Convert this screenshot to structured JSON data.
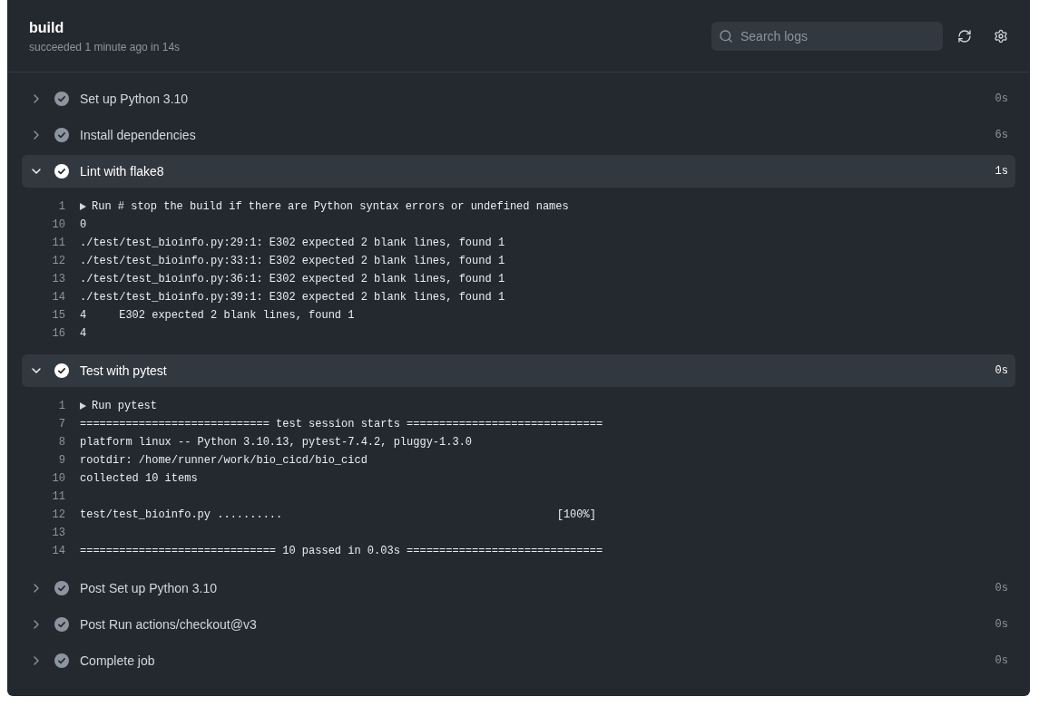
{
  "job": {
    "title": "build",
    "summary": "succeeded 1 minute ago in 14s"
  },
  "search": {
    "placeholder": "Search logs"
  },
  "steps": [
    {
      "name": "Set up Python 3.10",
      "duration": "0s",
      "expanded": false
    },
    {
      "name": "Install dependencies",
      "duration": "6s",
      "expanded": false
    },
    {
      "name": "Lint with flake8",
      "duration": "1s",
      "expanded": true,
      "log": {
        "group": {
          "number": "1",
          "text": "Run # stop the build if there are Python syntax errors or undefined names",
          "expanded": false
        },
        "lines": [
          {
            "number": "10",
            "text": "0"
          },
          {
            "number": "11",
            "text": "./test/test_bioinfo.py:29:1: E302 expected 2 blank lines, found 1"
          },
          {
            "number": "12",
            "text": "./test/test_bioinfo.py:33:1: E302 expected 2 blank lines, found 1"
          },
          {
            "number": "13",
            "text": "./test/test_bioinfo.py:36:1: E302 expected 2 blank lines, found 1"
          },
          {
            "number": "14",
            "text": "./test/test_bioinfo.py:39:1: E302 expected 2 blank lines, found 1"
          },
          {
            "number": "15",
            "text": "4     E302 expected 2 blank lines, found 1"
          },
          {
            "number": "16",
            "text": "4"
          }
        ]
      }
    },
    {
      "name": "Test with pytest",
      "duration": "0s",
      "expanded": true,
      "log": {
        "group": {
          "number": "1",
          "text": "Run pytest",
          "expanded": false
        },
        "lines": [
          {
            "number": "7",
            "text": "============================= test session starts =============================="
          },
          {
            "number": "8",
            "text": "platform linux -- Python 3.10.13, pytest-7.4.2, pluggy-1.3.0"
          },
          {
            "number": "9",
            "text": "rootdir: /home/runner/work/bio_cicd/bio_cicd"
          },
          {
            "number": "10",
            "text": "collected 10 items"
          },
          {
            "number": "11"
          },
          {
            "number": "12",
            "text": "test/test_bioinfo.py ..........                                          [100%]"
          },
          {
            "number": "13"
          },
          {
            "number": "14",
            "text": "============================== 10 passed in 0.03s =============================="
          }
        ]
      }
    },
    {
      "name": "Post Set up Python 3.10",
      "duration": "0s",
      "expanded": false
    },
    {
      "name": "Post Run actions/checkout@v3",
      "duration": "0s",
      "expanded": false
    },
    {
      "name": "Complete job",
      "duration": "0s",
      "expanded": false
    }
  ]
}
